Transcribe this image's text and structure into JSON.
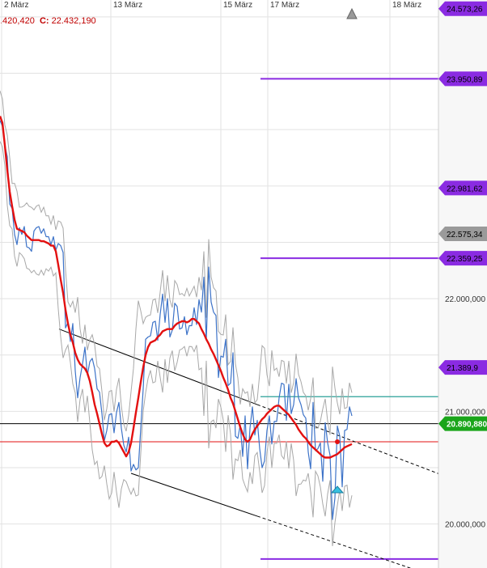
{
  "header": {
    "open_value": ".420,420",
    "close_label": "C:",
    "close_value": "22.432,190"
  },
  "colors": {
    "price_series": "#3d73c8",
    "moving_average": "#e31010",
    "band": "#a8a8a8",
    "purple_level": "#8a2be2",
    "teal_level": "#2aa198",
    "black_level": "#000000",
    "red_level": "#e31010",
    "last_price_tag": "#1aa51a",
    "trend_lines": "#000000"
  },
  "icons": {
    "scroll_up": "triangle-up-icon",
    "signal": "cyan-triangle-marker-icon"
  },
  "chart_data": {
    "type": "line",
    "x_ticks": [
      "2 März",
      "13 März",
      "15 März",
      "17 März",
      "18 März"
    ],
    "y_ticks": [
      "22.000,000",
      "21.000,000",
      "20.000,000"
    ],
    "ylim": [
      19610,
      24650
    ],
    "grid": true,
    "x": [
      0,
      3,
      6,
      9,
      12,
      15,
      18,
      21,
      24,
      27,
      30,
      33,
      36,
      39,
      42,
      45,
      48,
      51,
      54,
      57,
      60,
      63,
      66,
      69,
      72,
      75,
      78,
      81,
      84,
      87,
      90,
      93,
      96,
      99,
      102,
      105,
      108,
      111,
      114,
      117,
      120,
      123,
      126,
      129,
      132,
      135,
      138,
      141,
      144,
      147,
      150,
      153,
      156,
      159,
      162,
      165,
      168,
      171,
      174,
      177,
      180,
      183,
      186,
      189,
      192,
      195,
      198,
      201,
      204,
      207,
      210,
      213,
      216,
      219,
      222,
      225,
      228,
      231,
      234,
      237,
      240,
      243,
      246,
      249,
      252,
      255,
      258,
      261,
      264,
      267,
      270,
      273,
      276,
      279,
      282,
      285,
      288,
      291,
      294,
      297,
      300,
      303,
      306,
      309,
      312,
      315,
      318,
      321,
      324,
      327,
      330,
      333,
      336,
      339,
      342,
      345,
      348,
      351,
      354,
      357,
      360,
      363,
      366,
      369,
      372,
      375,
      378,
      381,
      384,
      387,
      390,
      393,
      396,
      399,
      402,
      405,
      408,
      411,
      414,
      417,
      420,
      423,
      426,
      429,
      432,
      435
    ],
    "series": [
      {
        "values": [
          23580,
          23530,
          23360,
          23260,
          22840,
          22800,
          22570,
          22480,
          22630,
          22570,
          22640,
          22460,
          22450,
          22420,
          22600,
          22630,
          22640,
          22580,
          22620,
          22550,
          22550,
          22480,
          22550,
          22430,
          22490,
          22470,
          22410,
          21740,
          21790,
          21620,
          21780,
          21360,
          21120,
          21300,
          21420,
          21570,
          21320,
          21440,
          21470,
          21380,
          21200,
          21170,
          20980,
          20740,
          20830,
          20970,
          20980,
          20810,
          20990,
          21080,
          20850,
          20700,
          20640,
          20770,
          20470,
          20530,
          20480,
          20500,
          20850,
          21200,
          21640,
          21660,
          21670,
          21790,
          21800,
          21630,
          21860,
          22040,
          21790,
          22000,
          21660,
          21720,
          21960,
          21930,
          21730,
          21740,
          21840,
          21680,
          21760,
          21760,
          21920,
          21770,
          21990,
          21880,
          22190,
          21630,
          22280,
          21970,
          21880,
          21850,
          21300,
          21490,
          21480,
          21640,
          21230,
          21250,
          21520,
          20780,
          20760,
          20880,
          20600,
          20960,
          20490,
          20850,
          21040,
          20790,
          20920,
          20670,
          20500,
          20560,
          20830,
          20960,
          20710,
          20910,
          20910,
          21120,
          21250,
          21240,
          20920,
          21240,
          20980,
          21060,
          21290,
          21120,
          21060,
          20970,
          20940,
          20640,
          20490,
          21080,
          20650,
          20670,
          20720,
          20380,
          20900,
          20720,
          20610,
          20040,
          20230,
          20870,
          20780,
          20330,
          20830,
          20840,
          21040,
          20960
        ],
        "color_key": "price_series"
      },
      {
        "values": [
          23620,
          23560,
          23360,
          23140,
          22950,
          22820,
          22700,
          22620,
          22610,
          22600,
          22590,
          22560,
          22540,
          22520,
          22520,
          22520,
          22520,
          22510,
          22510,
          22500,
          22490,
          22470,
          22470,
          22420,
          22300,
          22170,
          22050,
          21900,
          21780,
          21680,
          21610,
          21520,
          21460,
          21420,
          21400,
          21380,
          21340,
          21270,
          21170,
          21060,
          20980,
          20890,
          20800,
          20720,
          20690,
          20700,
          20730,
          20730,
          20740,
          20720,
          20680,
          20640,
          20600,
          20640,
          20720,
          20850,
          20990,
          21120,
          21260,
          21390,
          21500,
          21570,
          21610,
          21620,
          21630,
          21660,
          21680,
          21710,
          21720,
          21730,
          21730,
          21730,
          21760,
          21780,
          21790,
          21800,
          21800,
          21790,
          21800,
          21820,
          21820,
          21800,
          21780,
          21730,
          21690,
          21640,
          21600,
          21550,
          21510,
          21460,
          21410,
          21360,
          21300,
          21250,
          21190,
          21120,
          21070,
          21000,
          20930,
          20860,
          20800,
          20750,
          20730,
          20750,
          20800,
          20840,
          20870,
          20900,
          20930,
          20950,
          20980,
          21000,
          21020,
          21040,
          21050,
          21050,
          21030,
          21010,
          20990,
          20970,
          20940,
          20910,
          20880,
          20840,
          20810,
          20780,
          20760,
          20730,
          20700,
          20680,
          20660,
          20640,
          20620,
          20600,
          20590,
          20590,
          20590,
          20600,
          20610,
          20620,
          20640,
          20660,
          20680,
          20690,
          20700,
          20710
        ],
        "color_key": "moving_average"
      }
    ],
    "levels": [
      {
        "value": 24573.26,
        "label": "24.573,26",
        "color_key": "purple_level"
      },
      {
        "value": 23950.89,
        "label": "23.950,89",
        "color_key": "purple_level"
      },
      {
        "value": 22981.62,
        "label": "22.981,62",
        "color_key": "purple_level"
      },
      {
        "value": 22575.34,
        "label": "22.575,34",
        "color_key": "band"
      },
      {
        "value": 22359.25,
        "label": "22.359,25",
        "color_key": "purple_level"
      },
      {
        "value": 21389.9,
        "label": "21.389,9",
        "color_key": "purple_level"
      },
      {
        "value": 21130,
        "label": "",
        "color_key": "teal_level"
      },
      {
        "value": 20890.88,
        "label": "20.890,880",
        "color_key": "black_level"
      },
      {
        "value": 20730,
        "label": "",
        "color_key": "red_level"
      },
      {
        "value": 19690,
        "label": "",
        "color_key": "purple_level"
      }
    ],
    "trend_lines": [
      {
        "from": [
          73,
          21730
        ],
        "to": [
          318,
          21060
        ],
        "extend_to_x": 542
      },
      {
        "from": [
          162,
          20450
        ],
        "to": [
          318,
          20070
        ],
        "extend_to_x": 542
      }
    ]
  }
}
